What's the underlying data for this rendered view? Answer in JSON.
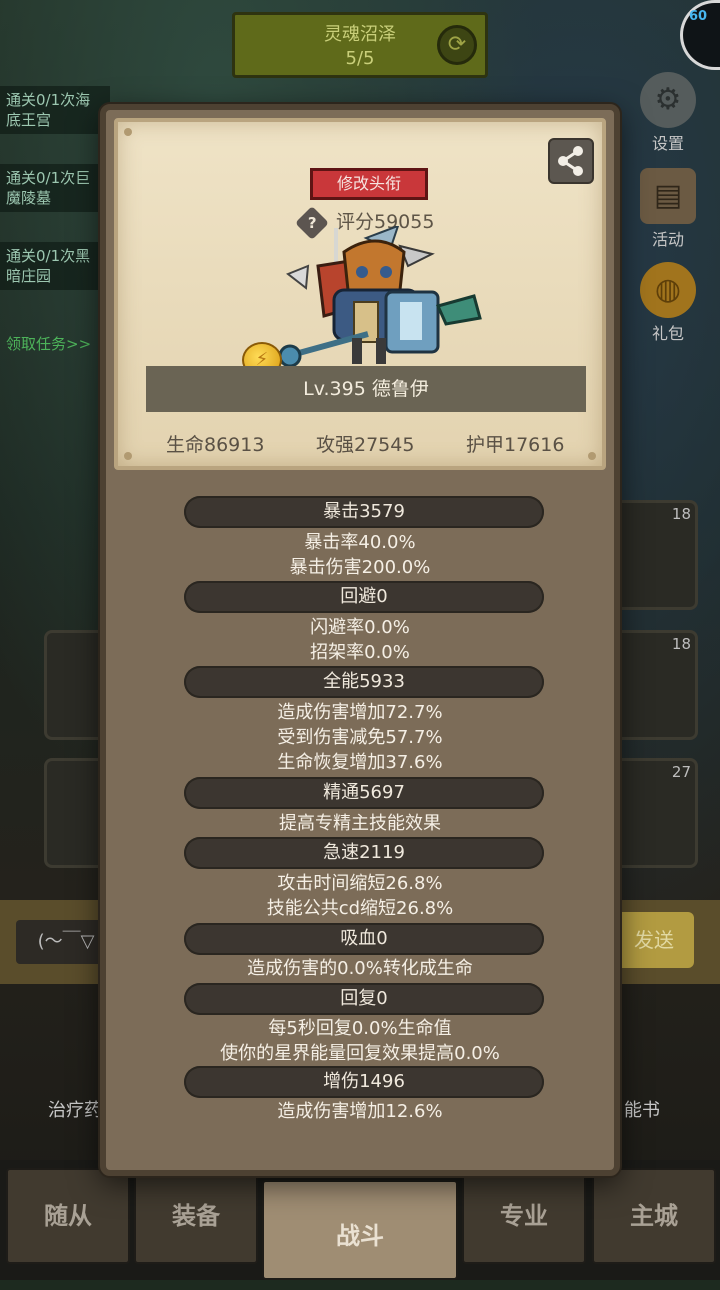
{
  "background": {
    "banner": {
      "title": "灵魂沼泽",
      "progress": "5/5"
    },
    "fps": "60",
    "quests": [
      {
        "text": "通关0/1次海底王宫"
      },
      {
        "text": "通关0/1次巨魔陵墓"
      },
      {
        "text": "通关0/1次黑暗庄园"
      }
    ],
    "quest_link": "领取任务>>",
    "side_buttons": [
      {
        "label": "设置",
        "icon": "gear-icon"
      },
      {
        "label": "活动",
        "icon": "scroll-icon"
      },
      {
        "label": "礼包",
        "icon": "gift-icon"
      }
    ],
    "slot_counts": [
      "18",
      "18",
      "27"
    ],
    "chat": {
      "input": "(～￣▽",
      "send": "发送"
    },
    "bottom_labels": [
      "治疗药",
      "能书"
    ],
    "tabs": [
      "随从",
      "装备",
      "战斗",
      "专业",
      "主城"
    ],
    "active_tab": "战斗"
  },
  "dialog": {
    "title_button": "修改头衔",
    "score_help": "?",
    "score": "评分59055",
    "coin_icon": "coin-icon",
    "level_name": "Lv.395 德鲁伊",
    "stats": {
      "hp": "生命86913",
      "attack": "攻强27545",
      "armor": "护甲17616"
    },
    "attributes": [
      {
        "header": "暴击3579",
        "lines": [
          "暴击率40.0%",
          "暴击伤害200.0%"
        ]
      },
      {
        "header": "回避0",
        "lines": [
          "闪避率0.0%",
          "招架率0.0%"
        ]
      },
      {
        "header": "全能5933",
        "lines": [
          "造成伤害增加72.7%",
          "受到伤害减免57.7%",
          "生命恢复增加37.6%"
        ]
      },
      {
        "header": "精通5697",
        "lines": [
          "提高专精主技能效果"
        ]
      },
      {
        "header": "急速2119",
        "lines": [
          "攻击时间缩短26.8%",
          "技能公共cd缩短26.8%"
        ]
      },
      {
        "header": "吸血0",
        "lines": [
          "造成伤害的0.0%转化成生命"
        ]
      },
      {
        "header": "回复0",
        "lines": [
          "每5秒回复0.0%生命值",
          "使你的星界能量回复效果提高0.0%"
        ]
      },
      {
        "header": "增伤1496",
        "lines": [
          "造成伤害增加12.6%"
        ]
      }
    ]
  }
}
